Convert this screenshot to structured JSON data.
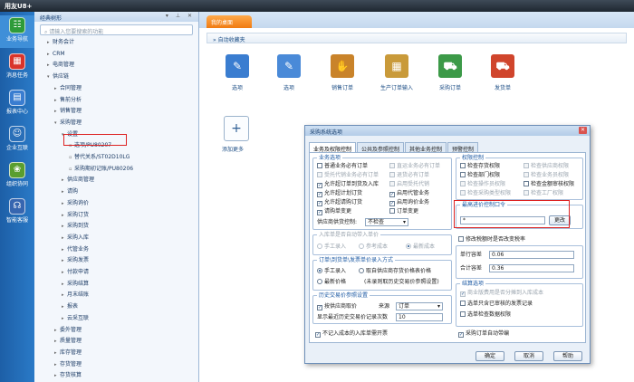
{
  "app": {
    "title": "用友U8+"
  },
  "leftnav": [
    {
      "label": "业务导航",
      "icon": "grid-icon",
      "color": "#2e9b3a",
      "glyph": "☷"
    },
    {
      "label": "消息任务",
      "icon": "calendar-icon",
      "color": "#d9342b",
      "glyph": "▦"
    },
    {
      "label": "报表中心",
      "icon": "report-icon",
      "color": "#3a7dd0",
      "glyph": "▤"
    },
    {
      "label": "企业互联",
      "icon": "people-icon",
      "color": "#2a6fb8",
      "glyph": "☺"
    },
    {
      "label": "组织协同",
      "icon": "leaf-icon",
      "color": "#5a9e2f",
      "glyph": "❀"
    },
    {
      "label": "智能客服",
      "icon": "headset-icon",
      "color": "#3766b0",
      "glyph": "☊"
    }
  ],
  "tree": {
    "header": "经典树形",
    "search_placeholder": "请输入您要搜索的功能",
    "items": [
      {
        "label": "财务会计",
        "level": 0,
        "state": "closed"
      },
      {
        "label": "CRM",
        "level": 0,
        "state": "closed"
      },
      {
        "label": "电商管理",
        "level": 0,
        "state": "closed"
      },
      {
        "label": "供应链",
        "level": 0,
        "state": "open"
      },
      {
        "label": "合同管理",
        "level": 1,
        "state": "closed"
      },
      {
        "label": "售前分析",
        "level": 1,
        "state": "closed"
      },
      {
        "label": "销售管理",
        "level": 1,
        "state": "closed"
      },
      {
        "label": "采购管理",
        "level": 1,
        "state": "open"
      },
      {
        "label": "设置",
        "level": 2,
        "state": "open"
      },
      {
        "label": "选项/PU80207",
        "level": 3,
        "state": "leaf"
      },
      {
        "label": "替代关系/ST02D10LG",
        "level": 3,
        "state": "leaf"
      },
      {
        "label": "采购期初记账/PU80206",
        "level": 3,
        "state": "leaf"
      },
      {
        "label": "供应商管理",
        "level": 2,
        "state": "closed"
      },
      {
        "label": "请购",
        "level": 2,
        "state": "closed"
      },
      {
        "label": "采购询价",
        "level": 2,
        "state": "closed"
      },
      {
        "label": "采购订货",
        "level": 2,
        "state": "closed"
      },
      {
        "label": "采购到货",
        "level": 2,
        "state": "closed"
      },
      {
        "label": "采购入库",
        "level": 2,
        "state": "closed"
      },
      {
        "label": "代管业务",
        "level": 2,
        "state": "closed"
      },
      {
        "label": "采购发票",
        "level": 2,
        "state": "closed"
      },
      {
        "label": "付款申请",
        "level": 2,
        "state": "closed"
      },
      {
        "label": "采购结算",
        "level": 2,
        "state": "closed"
      },
      {
        "label": "月末结账",
        "level": 2,
        "state": "closed"
      },
      {
        "label": "报表",
        "level": 2,
        "state": "closed"
      },
      {
        "label": "云采互联",
        "level": 2,
        "state": "closed"
      },
      {
        "label": "委外管理",
        "level": 1,
        "state": "closed"
      },
      {
        "label": "质量管理",
        "level": 1,
        "state": "closed"
      },
      {
        "label": "库存管理",
        "level": 1,
        "state": "closed"
      },
      {
        "label": "存货管理",
        "level": 1,
        "state": "closed"
      },
      {
        "label": "存货核算",
        "level": 1,
        "state": "closed"
      }
    ]
  },
  "tabs": {
    "active": "我的桌面"
  },
  "desktop": {
    "favorites_label": "自动收藏夹",
    "shortcuts": [
      {
        "label": "选项",
        "icon": "options-icon",
        "color": "#3a7dd0",
        "glyph": "✎"
      },
      {
        "label": "选项",
        "icon": "options-icon",
        "color": "#4a8ad8",
        "glyph": "✎"
      },
      {
        "label": "销售订单",
        "icon": "handshake-icon",
        "color": "#c9832a",
        "glyph": "✋"
      },
      {
        "label": "生产订单输入",
        "icon": "calculator-icon",
        "color": "#c99a3a",
        "glyph": "▦"
      },
      {
        "label": "采购订单",
        "icon": "cart-icon",
        "color": "#3c9a48",
        "glyph": "⛟"
      },
      {
        "label": "发货单",
        "icon": "truck-icon",
        "color": "#d0452c",
        "glyph": "⛟"
      }
    ],
    "add_label": "添加更多"
  },
  "dialog": {
    "title": "采购系统选项",
    "tabs": [
      "业务及权限控制",
      "公共及参照控制",
      "其他业务控制",
      "预警控制"
    ],
    "biz": {
      "title": "业务选项",
      "items": [
        {
          "label": "普通业务必有订单",
          "checked": false,
          "enabled": true
        },
        {
          "label": "直运业务必有订单",
          "checked": false,
          "enabled": false
        },
        {
          "label": "受托代销业务必有订单",
          "checked": false,
          "enabled": false
        },
        {
          "label": "退货必有订单",
          "checked": false,
          "enabled": false
        },
        {
          "label": "允许超订单到货及入库",
          "checked": true,
          "enabled": true
        },
        {
          "label": "启用受托代销",
          "checked": false,
          "enabled": false
        },
        {
          "label": "允许超计划订货",
          "checked": true,
          "enabled": true
        },
        {
          "label": "启用代管业务",
          "checked": true,
          "enabled": true
        },
        {
          "label": "允许超请购订货",
          "checked": true,
          "enabled": true
        },
        {
          "label": "启用询价业务",
          "checked": true,
          "enabled": true
        },
        {
          "label": "请购单变更",
          "checked": true,
          "enabled": true
        },
        {
          "label": "订单变更",
          "checked": false,
          "enabled": true
        }
      ],
      "supplier_label": "供应商供货控制:",
      "supplier_value": "不检查"
    },
    "perm": {
      "title": "权限控制",
      "items": [
        {
          "label": "检查存货权限",
          "checked": false,
          "enabled": true
        },
        {
          "label": "检查供应商权限",
          "checked": false,
          "enabled": false
        },
        {
          "label": "检查部门权限",
          "checked": false,
          "enabled": true
        },
        {
          "label": "检查业务员权限",
          "checked": false,
          "enabled": false
        },
        {
          "label": "检查操作员权限",
          "checked": false,
          "enabled": false
        },
        {
          "label": "检查金额审核权限",
          "checked": false,
          "enabled": true
        },
        {
          "label": "检查采购类型权限",
          "checked": false,
          "enabled": false
        },
        {
          "label": "检查工厂权限",
          "checked": false,
          "enabled": false
        }
      ]
    },
    "max_price": {
      "title": "最高进价控制口令",
      "value": "*",
      "change_btn": "更改"
    },
    "inbound": {
      "title": "入库单是否自动带入单价",
      "options": [
        {
          "label": "手工录入",
          "selected": false
        },
        {
          "label": "参考成本",
          "selected": false
        },
        {
          "label": "最新成本",
          "selected": true
        }
      ]
    },
    "price_entry": {
      "title": "订单\\到货单\\发票单价录入方式",
      "options": [
        {
          "label": "手工录入",
          "selected": true
        },
        {
          "label": "取自供应商存货价格表价格",
          "selected": false
        },
        {
          "label": "最新价格",
          "selected": false
        }
      ],
      "note": "(未录则取历史交易价参照设置)"
    },
    "history": {
      "title": "历史交易价参照设置",
      "supplier_check": "按供应商取价",
      "source_label": "来源",
      "source_value": "订单",
      "count_label": "显示最近历史交易价记录次数",
      "count_value": "10"
    },
    "tax": {
      "check_label": "修改税额时是否改变税率",
      "rate_label": "单行容差",
      "rate_value": "0.06",
      "total_label": "合计容差",
      "total_value": "0.36"
    },
    "settle": {
      "title": "结算选项",
      "items": [
        {
          "label": "商业版费用是否分摊到入库成本",
          "checked": true,
          "enabled": false
        },
        {
          "label": "选单只含已审核的发票记录",
          "checked": false,
          "enabled": true
        },
        {
          "label": "选单检查数据权限",
          "checked": false,
          "enabled": true
        }
      ]
    },
    "bottom_left": {
      "label": "不记入成本的入库单需开票",
      "checked": true
    },
    "bottom_right": {
      "label": "采购订单自动带编",
      "checked": true
    },
    "buttons": {
      "ok": "确定",
      "cancel": "取消",
      "help": "帮助"
    }
  }
}
